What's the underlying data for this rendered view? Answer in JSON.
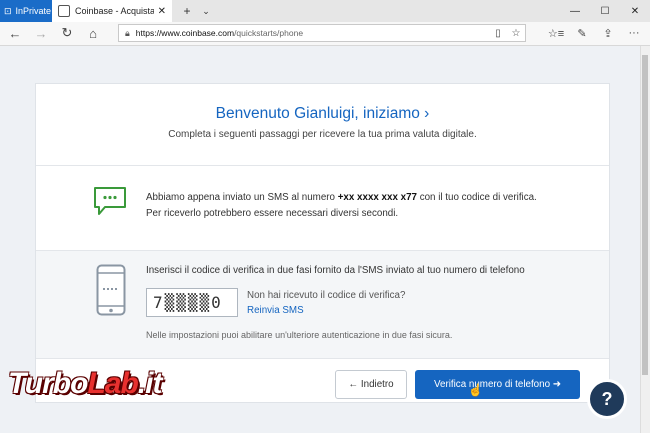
{
  "browser": {
    "inprivate_label": "InPrivate",
    "tab_title": "Coinbase - Acquista/ver",
    "url_host": "https://www.coinbase.com",
    "url_path": "/quickstarts/phone"
  },
  "page": {
    "heading": "Benvenuto Gianluigi, iniziamo ›",
    "subheading": "Completa i seguenti passaggi per ricevere la tua prima valuta digitale.",
    "sms": {
      "text_before": "Abbiamo appena inviato un SMS al numero ",
      "phone_number": "+xx xxxx xxx x77",
      "text_after": " con il tuo codice di verifica.",
      "line2": "Per riceverlo potrebbero essere necessari diversi secondi."
    },
    "code": {
      "prompt": "Inserisci il codice di verifica in due fasi fornito da l'SMS inviato al tuo numero di telefono",
      "value": "7▒▒▒▒0",
      "not_received": "Non hai ricevuto il codice di verifica?",
      "resend": "Reinvia SMS",
      "settings_note": "Nelle impostazioni puoi abilitare un'ulteriore autenticazione in due fasi sicura."
    },
    "buttons": {
      "back": "← Indietro",
      "verify": "Verifica numero di telefono ➜"
    },
    "help_label": "?"
  },
  "watermark": {
    "part1": "Turbo",
    "part2": "Lab",
    "part3": ".it"
  },
  "colors": {
    "accent": "#1565c0",
    "sms_icon": "#3a9a3a",
    "help": "#1f3a5a"
  },
  "icons": [
    "back-arrow-icon",
    "forward-arrow-icon",
    "refresh-icon",
    "home-icon",
    "lock-icon",
    "reading-view-icon",
    "favorite-star-icon",
    "favorites-list-icon",
    "pen-icon",
    "share-icon",
    "more-icon",
    "sms-bubble-icon",
    "phone-icon",
    "help-icon"
  ]
}
